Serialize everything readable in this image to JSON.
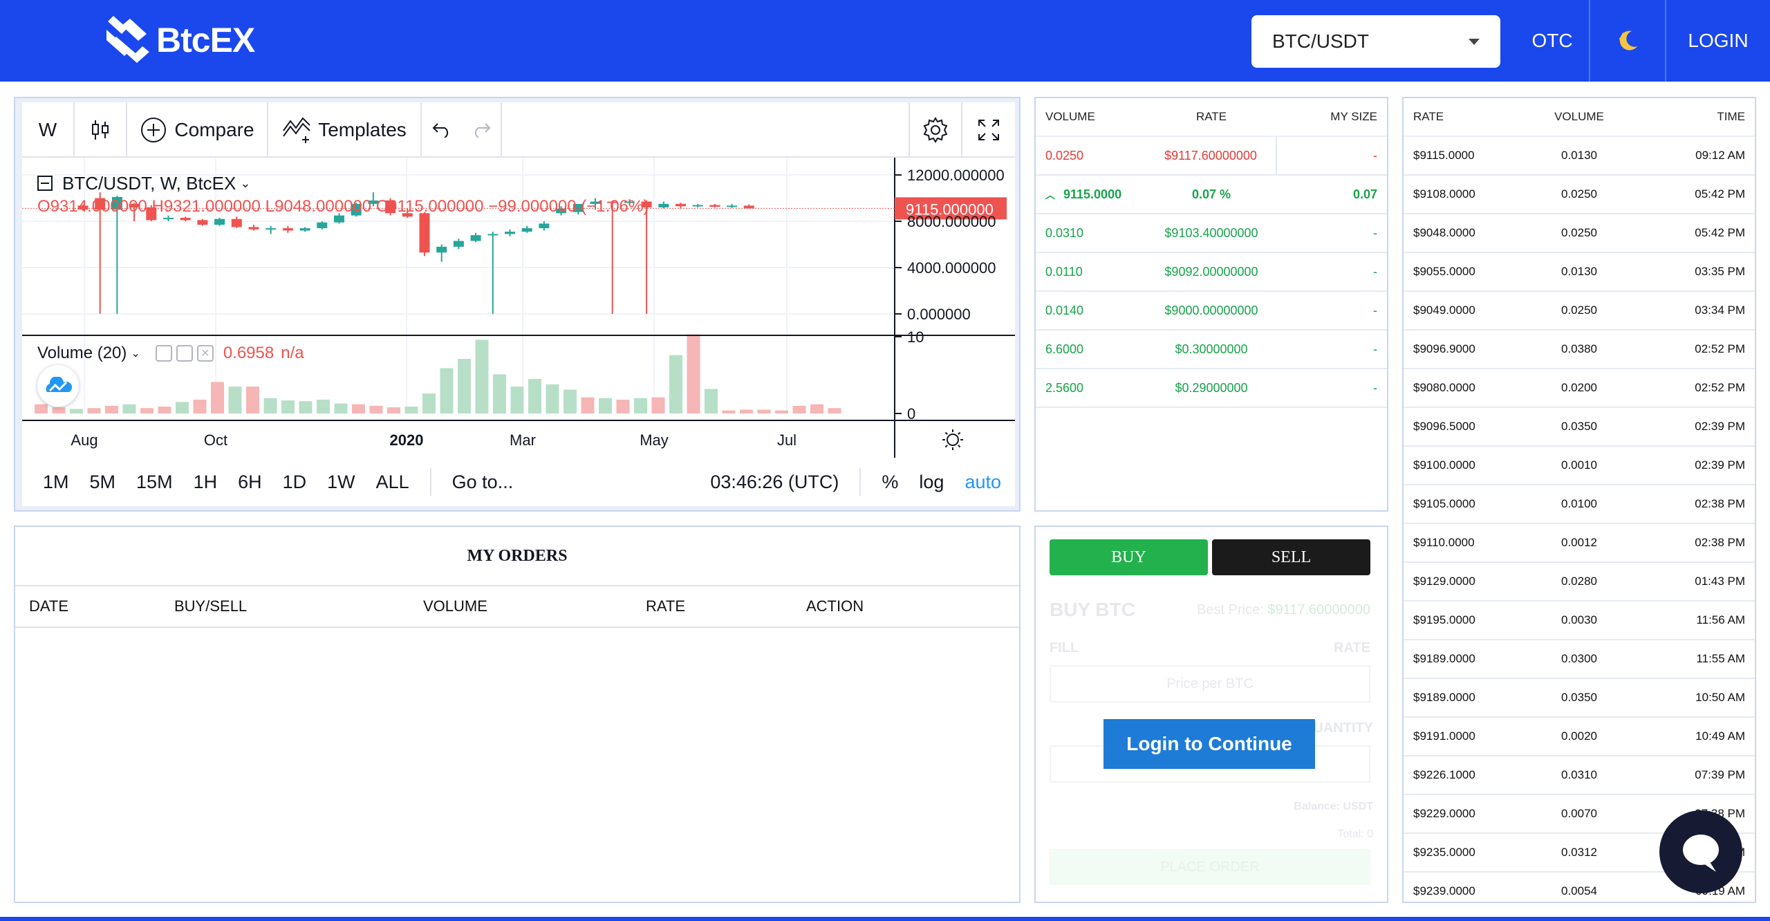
{
  "header": {
    "logo_text": "BtcEX",
    "pair": "BTC/USDT",
    "otc": "OTC",
    "login": "LOGIN"
  },
  "chart": {
    "toolbar": {
      "interval": "W",
      "compare": "Compare",
      "templates": "Templates"
    },
    "legend": {
      "symbol": "BTC/USDT, W, BtcEX",
      "ohlc": "O9314.000000 H9321.000000 L9048.000000 C9115.000000 −99.000000 (−1.06%)"
    },
    "volume_legend": {
      "label": "Volume (20)",
      "value": "0.6958",
      "na": "n/a"
    },
    "price_axis": [
      "12000.000000",
      "8000.000000",
      "4000.000000",
      "0.000000"
    ],
    "last_price": "9115.000000",
    "volume_axis": [
      "10",
      "0"
    ],
    "time_axis": [
      "Aug",
      "Oct",
      "2020",
      "Mar",
      "May",
      "Jul"
    ],
    "timeframes": [
      "1M",
      "5M",
      "15M",
      "1H",
      "6H",
      "1D",
      "1W",
      "ALL"
    ],
    "goto": "Go to...",
    "clock": "03:46:26 (UTC)",
    "pct": "%",
    "log": "log",
    "auto": "auto",
    "colors": {
      "up": "#26a69a",
      "down": "#ef5350",
      "up_vol": "#b7dfc8",
      "down_vol": "#f5b6b5"
    },
    "chart_data": {
      "type": "candlestick",
      "candles": [
        [
          9350,
          9450,
          8900,
          9000
        ],
        [
          10000,
          10500,
          8,
          9000
        ],
        [
          9000,
          10200,
          8,
          10100
        ],
        [
          9500,
          9600,
          8000,
          9200
        ],
        [
          9200,
          9400,
          8000,
          8100
        ],
        [
          8200,
          8500,
          8000,
          8300
        ],
        [
          8300,
          8400,
          8000,
          8100
        ],
        [
          8100,
          8200,
          7600,
          7700
        ],
        [
          7700,
          8300,
          7600,
          8200
        ],
        [
          8200,
          8400,
          7400,
          7500
        ],
        [
          7500,
          7700,
          7200,
          7300
        ],
        [
          7300,
          7600,
          6900,
          7400
        ],
        [
          7400,
          7600,
          7000,
          7200
        ],
        [
          7200,
          7500,
          7100,
          7400
        ],
        [
          7400,
          8000,
          7300,
          7900
        ],
        [
          7900,
          8700,
          7800,
          8500
        ],
        [
          8500,
          9600,
          8400,
          9500
        ],
        [
          9500,
          10500,
          9300,
          9800
        ],
        [
          9800,
          10000,
          8500,
          8700
        ],
        [
          8700,
          9100,
          8300,
          8400
        ],
        [
          8700,
          8800,
          5000,
          5300
        ],
        [
          5300,
          6000,
          4500,
          5800
        ],
        [
          5800,
          6500,
          5600,
          6300
        ],
        [
          6300,
          7000,
          6200,
          6800
        ],
        [
          6800,
          7100,
          0,
          6900
        ],
        [
          6900,
          7300,
          6700,
          7100
        ],
        [
          7100,
          7600,
          7000,
          7400
        ],
        [
          7400,
          8000,
          7200,
          7800
        ],
        [
          8700,
          9300,
          8500,
          9100
        ],
        [
          8800,
          9200,
          8600,
          9500
        ],
        [
          9500,
          10000,
          9000,
          9700
        ],
        [
          9700,
          9800,
          0,
          9600
        ],
        [
          9600,
          9900,
          9400,
          9700
        ],
        [
          9700,
          9800,
          0,
          9200
        ],
        [
          9200,
          9700,
          9100,
          9500
        ],
        [
          9500,
          9600,
          9100,
          9300
        ],
        [
          9300,
          9500,
          9200,
          9400
        ],
        [
          9400,
          9500,
          9200,
          9250
        ],
        [
          9250,
          9500,
          9150,
          9350
        ],
        [
          9350,
          9450,
          9100,
          9115
        ]
      ],
      "volumes": [
        1.2,
        0.8,
        0.6,
        0.7,
        1.0,
        1.2,
        0.7,
        0.9,
        1.5,
        1.8,
        4.1,
        3.5,
        3.5,
        2.0,
        1.7,
        1.6,
        1.8,
        1.3,
        1.2,
        1.0,
        0.8,
        0.9,
        2.6,
        5.9,
        7.1,
        9.6,
        5.1,
        3.5,
        4.5,
        3.8,
        3.1,
        2.1,
        2.0,
        1.8,
        2.0,
        2.1,
        7.6,
        10.3,
        3.2,
        0.4,
        0.5,
        0.5,
        0.4,
        1.0,
        1.2,
        0.7
      ]
    }
  },
  "orderbook": {
    "headers": [
      "VOLUME",
      "RATE",
      "MY SIZE"
    ],
    "asks": [
      {
        "volume": "0.0250",
        "rate": "$9117.60000000",
        "my": "-"
      }
    ],
    "mid": {
      "price": "9115.0000",
      "spread": "0.07 %",
      "my": "0.07"
    },
    "bids": [
      {
        "volume": "0.0310",
        "rate": "$9103.40000000",
        "my": "-"
      },
      {
        "volume": "0.0110",
        "rate": "$9092.00000000",
        "my": "-"
      },
      {
        "volume": "0.0140",
        "rate": "$9000.00000000",
        "my": "-"
      },
      {
        "volume": "6.6000",
        "rate": "$0.30000000",
        "my": "-"
      },
      {
        "volume": "2.5600",
        "rate": "$0.29000000",
        "my": "-"
      }
    ]
  },
  "trades": {
    "headers": [
      "RATE",
      "VOLUME",
      "TIME"
    ],
    "rows": [
      {
        "rate": "$9115.0000",
        "volume": "0.0130",
        "time": "09:12 AM"
      },
      {
        "rate": "$9108.0000",
        "volume": "0.0250",
        "time": "05:42 PM"
      },
      {
        "rate": "$9048.0000",
        "volume": "0.0250",
        "time": "05:42 PM"
      },
      {
        "rate": "$9055.0000",
        "volume": "0.0130",
        "time": "03:35 PM"
      },
      {
        "rate": "$9049.0000",
        "volume": "0.0250",
        "time": "03:34 PM"
      },
      {
        "rate": "$9096.9000",
        "volume": "0.0380",
        "time": "02:52 PM"
      },
      {
        "rate": "$9080.0000",
        "volume": "0.0200",
        "time": "02:52 PM"
      },
      {
        "rate": "$9096.5000",
        "volume": "0.0350",
        "time": "02:39 PM"
      },
      {
        "rate": "$9100.0000",
        "volume": "0.0010",
        "time": "02:39 PM"
      },
      {
        "rate": "$9105.0000",
        "volume": "0.0100",
        "time": "02:38 PM"
      },
      {
        "rate": "$9110.0000",
        "volume": "0.0012",
        "time": "02:38 PM"
      },
      {
        "rate": "$9129.0000",
        "volume": "0.0280",
        "time": "01:43 PM"
      },
      {
        "rate": "$9195.0000",
        "volume": "0.0030",
        "time": "11:56 AM"
      },
      {
        "rate": "$9189.0000",
        "volume": "0.0300",
        "time": "11:55 AM"
      },
      {
        "rate": "$9189.0000",
        "volume": "0.0350",
        "time": "10:50 AM"
      },
      {
        "rate": "$9191.0000",
        "volume": "0.0020",
        "time": "10:49 AM"
      },
      {
        "rate": "$9226.1000",
        "volume": "0.0310",
        "time": "07:39 PM"
      },
      {
        "rate": "$9229.0000",
        "volume": "0.0070",
        "time": "07:38 PM"
      },
      {
        "rate": "$9235.0000",
        "volume": "0.0312",
        "time": "07:35 PM"
      },
      {
        "rate": "$9239.0000",
        "volume": "0.0054",
        "time": "09:19 AM"
      }
    ]
  },
  "my_orders": {
    "title": "MY ORDERS",
    "headers": [
      "DATE",
      "BUY/SELL",
      "VOLUME",
      "RATE",
      "ACTION"
    ]
  },
  "trade_form": {
    "buy": "BUY",
    "sell": "SELL",
    "title": "BUY BTC",
    "best_price_label": "Best Price:",
    "best_price": "$9117.60000000",
    "fill": "FILL",
    "rate": "RATE",
    "rate_placeholder": "Price per BTC",
    "quantity": "QUANTITY",
    "balance": "Balance: USDT",
    "total": "Total: 0",
    "place_order": "PLACE ORDER",
    "login_to_continue": "Login to Continue"
  }
}
